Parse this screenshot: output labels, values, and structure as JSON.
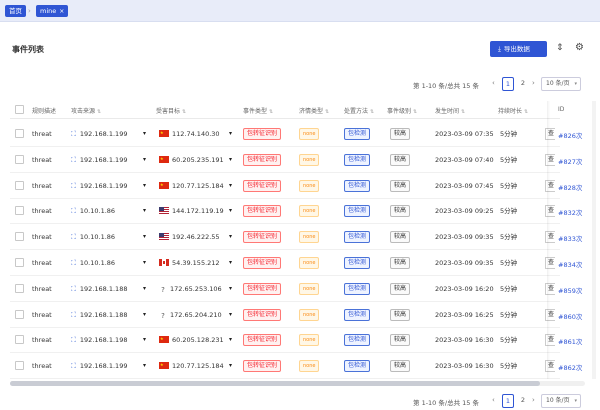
{
  "breadcrumb": {
    "home": "首页",
    "separator": "›",
    "current_tag": "mine",
    "close": "×"
  },
  "page": {
    "title": "事件列表",
    "export_label": "导出数据",
    "export_icon": "download-icon",
    "tool_icons": [
      "column-height-icon",
      "settings-icon"
    ]
  },
  "pagination_top": {
    "summary": "第 1-10 条/总共 15 条",
    "prev": "‹",
    "next": "›",
    "pages": [
      "1",
      "2"
    ],
    "active_page": "1",
    "page_size": "10 条/页",
    "dropdown": "▾"
  },
  "pagination_bottom": {
    "summary": "第 1-10 条/总共 15 条",
    "prev": "‹",
    "next": "›",
    "pages": [
      "1",
      "2"
    ],
    "active_page": "1",
    "page_size": "10 条/页",
    "dropdown": "▾"
  },
  "columns": [
    "规则描述",
    "攻击来源",
    "受害目标",
    "事件类型",
    "济情类型",
    "处置方法",
    "事件级别",
    "发生时间",
    "持续时长",
    "ID"
  ],
  "sort_icon": "⇅",
  "rows": [
    {
      "desc": "threat",
      "src": "192.168.1.199",
      "flag": "cn",
      "dst": "112.74.140.30",
      "type": "包转征识别",
      "sub": "none",
      "method": "包检测",
      "level": "较高",
      "time": "2023-03-09 07:35",
      "dur": "5分钟",
      "op": "查",
      "id": "#826次"
    },
    {
      "desc": "threat",
      "src": "192.168.1.199",
      "flag": "cn",
      "dst": "60.205.235.191",
      "type": "包转征识别",
      "sub": "none",
      "method": "包检测",
      "level": "较高",
      "time": "2023-03-09 07:40",
      "dur": "5分钟",
      "op": "查",
      "id": "#827次"
    },
    {
      "desc": "threat",
      "src": "192.168.1.199",
      "flag": "cn",
      "dst": "120.77.125.184",
      "type": "包转征识别",
      "sub": "none",
      "method": "包检测",
      "level": "较高",
      "time": "2023-03-09 07:45",
      "dur": "5分钟",
      "op": "查",
      "id": "#828次"
    },
    {
      "desc": "threat",
      "src": "10.10.1.86",
      "flag": "us",
      "dst": "144.172.119.19",
      "type": "包转征识别",
      "sub": "none",
      "method": "包检测",
      "level": "较高",
      "time": "2023-03-09 09:25",
      "dur": "5分钟",
      "op": "查",
      "id": "#832次"
    },
    {
      "desc": "threat",
      "src": "10.10.1.86",
      "flag": "us",
      "dst": "192.46.222.55",
      "type": "包转征识别",
      "sub": "none",
      "method": "包检测",
      "level": "较高",
      "time": "2023-03-09 09:35",
      "dur": "5分钟",
      "op": "查",
      "id": "#833次"
    },
    {
      "desc": "threat",
      "src": "10.10.1.86",
      "flag": "ca",
      "dst": "54.39.155.212",
      "type": "包转征识别",
      "sub": "none",
      "method": "包检测",
      "level": "较高",
      "time": "2023-03-09 09:35",
      "dur": "5分钟",
      "op": "查",
      "id": "#834次"
    },
    {
      "desc": "threat",
      "src": "192.168.1.188",
      "flag": "unk",
      "dst": "172.65.253.106",
      "type": "包转征识别",
      "sub": "none",
      "method": "包检测",
      "level": "较高",
      "time": "2023-03-09 16:20",
      "dur": "5分钟",
      "op": "查",
      "id": "#859次"
    },
    {
      "desc": "threat",
      "src": "192.168.1.188",
      "flag": "unk",
      "dst": "172.65.204.210",
      "type": "包转征识别",
      "sub": "none",
      "method": "包检测",
      "level": "较高",
      "time": "2023-03-09 16:25",
      "dur": "5分钟",
      "op": "查",
      "id": "#860次"
    },
    {
      "desc": "threat",
      "src": "192.168.1.198",
      "flag": "cn",
      "dst": "60.205.128.231",
      "type": "包转征识别",
      "sub": "none",
      "method": "包检测",
      "level": "较高",
      "time": "2023-03-09 16:30",
      "dur": "5分钟",
      "op": "查",
      "id": "#861次"
    },
    {
      "desc": "threat",
      "src": "192.168.1.199",
      "flag": "cn",
      "dst": "120.77.125.184",
      "type": "包转征识别",
      "sub": "none",
      "method": "包检测",
      "level": "较高",
      "time": "2023-03-09 16:30",
      "dur": "5分钟",
      "op": "查",
      "id": "#862次"
    }
  ],
  "icons": {
    "network": "network-icon",
    "dropdown": "▾",
    "unknown_flag": "?"
  },
  "colors": {
    "primary": "#2f55d4",
    "danger": "#f5222d",
    "warning": "#fa8c16"
  }
}
